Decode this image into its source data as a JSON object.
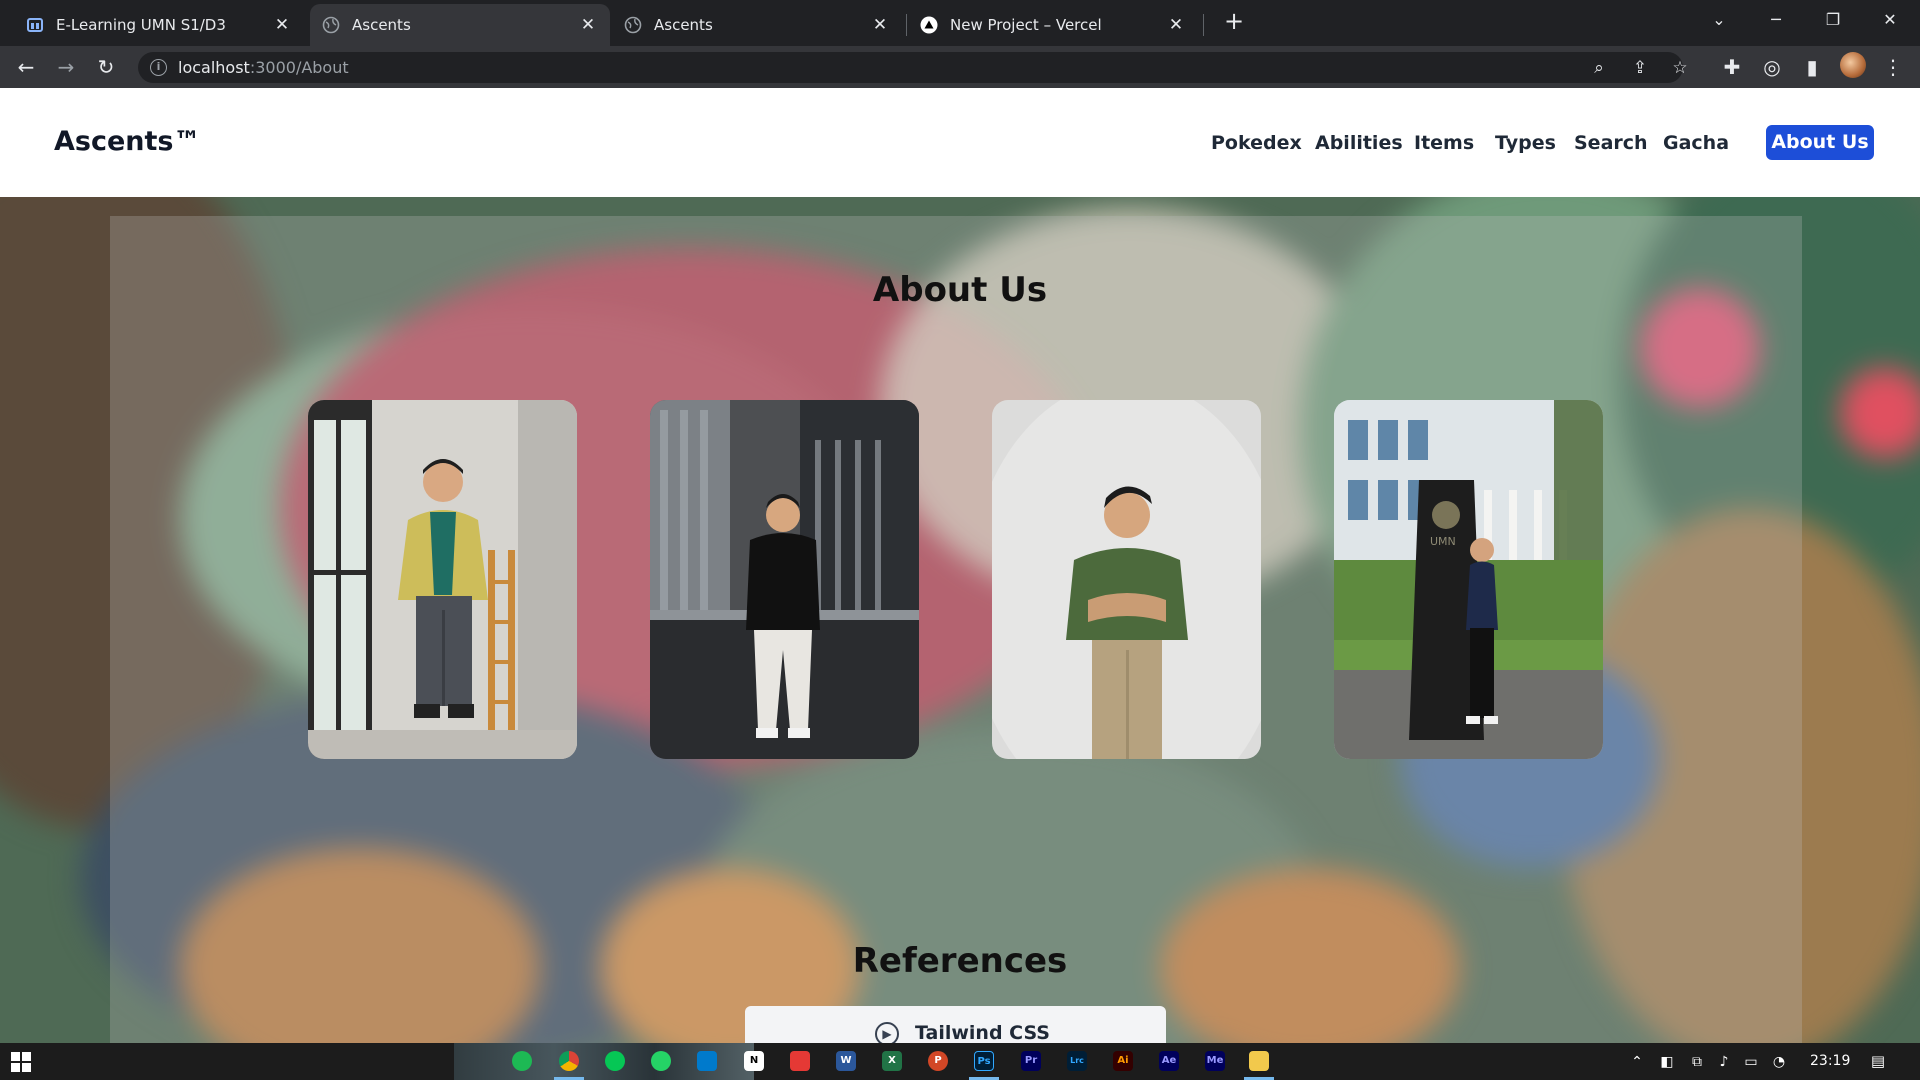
{
  "browser": {
    "tabs": [
      {
        "title": "E-Learning UMN S1/D3",
        "icon": "moodle-icon",
        "active": false
      },
      {
        "title": "Ascents",
        "icon": "globe-icon",
        "active": true
      },
      {
        "title": "Ascents",
        "icon": "globe-icon",
        "active": false
      },
      {
        "title": "New Project – Vercel",
        "icon": "vercel-icon",
        "active": false
      }
    ],
    "url_host": "localhost",
    "url_path": ":3000/About"
  },
  "site": {
    "brand": "Ascents™",
    "nav": [
      "Pokedex",
      "Abilities",
      "Items",
      "Types",
      "Search",
      "Gacha"
    ],
    "nav_active": "About Us",
    "about_title": "About Us",
    "members": [
      {
        "name": "member-1",
        "photo_icon": "person-photo"
      },
      {
        "name": "member-2",
        "photo_icon": "person-photo"
      },
      {
        "name": "member-3",
        "photo_icon": "person-photo"
      },
      {
        "name": "member-4",
        "photo_icon": "person-photo",
        "sign_text": "UMN"
      }
    ],
    "references_title": "References",
    "references": [
      {
        "label": "Tailwind CSS",
        "icon": "play-circle-icon"
      }
    ]
  },
  "taskbar": {
    "time": "23:19",
    "apps": [
      "spotify",
      "chrome",
      "line",
      "whatsapp",
      "vscode",
      "notion",
      "pdf",
      "word",
      "excel",
      "powerpoint",
      "photoshop",
      "premiere",
      "lightroom-classic",
      "illustrator",
      "after-effects",
      "media-encoder",
      "file-explorer"
    ],
    "app_labels": {
      "notion": "N",
      "word": "W",
      "excel": "X",
      "powerpoint": "P",
      "photoshop": "Ps",
      "premiere": "Pr",
      "lightroom": "Lrc",
      "illustrator": "Ai",
      "after_effects": "Ae",
      "media_encoder": "Me"
    }
  }
}
